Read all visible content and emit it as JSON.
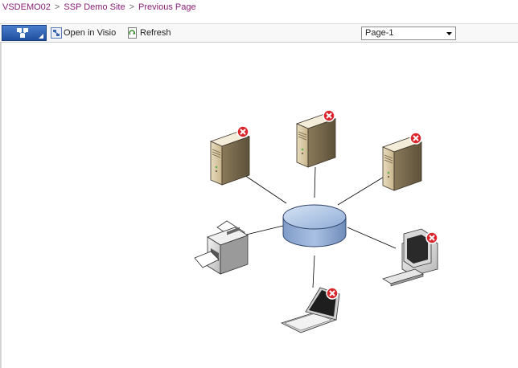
{
  "breadcrumb": {
    "items": [
      "VSDEMO02",
      "SSP Demo Site",
      "Previous Page"
    ],
    "separator": ">"
  },
  "toolbar": {
    "menu_icon": "visio-web-access-icon",
    "open_in_visio_label": "Open in Visio",
    "refresh_label": "Refresh",
    "page_select": {
      "value": "Page-1"
    }
  },
  "diagram": {
    "hub": "ethernet-hub",
    "nodes": [
      {
        "type": "server",
        "error": true
      },
      {
        "type": "server",
        "error": true
      },
      {
        "type": "server",
        "error": true
      },
      {
        "type": "printer",
        "error": false
      },
      {
        "type": "pc",
        "error": true
      },
      {
        "type": "laptop",
        "error": true
      }
    ]
  },
  "colors": {
    "link": "#8b2079",
    "ribbon_button": "#2d62b5",
    "hub_fill": "#9bb8e0",
    "error_red": "#d9262c"
  }
}
